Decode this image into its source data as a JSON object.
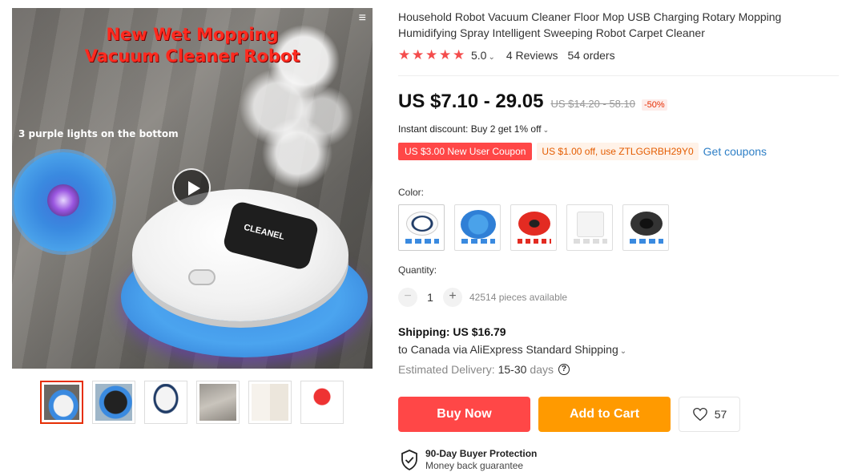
{
  "gallery": {
    "main_text_line1": "New Wet Mopping",
    "main_text_line2": "Vacuum Cleaner Robot",
    "main_caption": "3 purple lights on the bottom",
    "robot_brand": "CLEANEL",
    "menu_icon": "menu-icon",
    "play_icon": "play-icon",
    "thumbnails": [
      "thumb-1",
      "thumb-2",
      "thumb-3",
      "thumb-4",
      "thumb-5",
      "thumb-6"
    ],
    "active_thumbnail": 0
  },
  "product": {
    "title": "Household Robot Vacuum Cleaner Floor Mop USB Charging Rotary Mopping Humidifying Spray Intelligent Sweeping Robot Carpet Cleaner",
    "rating": "5.0",
    "stars": 5,
    "reviews": "4 Reviews",
    "orders": "54 orders"
  },
  "price": {
    "current": "US $7.10 - 29.05",
    "original": "US $14.20 - 58.10",
    "discount": "-50%"
  },
  "promo": {
    "instant_discount": "Instant discount: Buy 2 get 1% off",
    "coupon_new_user": "US $3.00 New User Coupon",
    "coupon_code": "US $1.00 off, use ZTLGGRBH29Y0",
    "get_coupons": "Get coupons"
  },
  "options": {
    "color_label": "Color:",
    "colors": [
      "white",
      "blue",
      "red",
      "white-box",
      "black"
    ],
    "quantity_label": "Quantity:",
    "quantity": "1",
    "available": "42514 pieces available"
  },
  "shipping": {
    "price": "Shipping: US $16.79",
    "detail": "to Canada via AliExpress Standard Shipping",
    "delivery_label": "Estimated Delivery:",
    "delivery_value": "15-30",
    "delivery_unit": "days"
  },
  "actions": {
    "buy_now": "Buy Now",
    "add_to_cart": "Add to Cart",
    "wishlist_count": "57"
  },
  "protection": {
    "title": "90-Day Buyer Protection",
    "subtitle": "Money back guarantee"
  },
  "colors": {
    "accent_red": "#ff4747",
    "accent_orange": "#ff9a00",
    "star": "#f44c4c",
    "link_blue": "#2e7fc6"
  }
}
